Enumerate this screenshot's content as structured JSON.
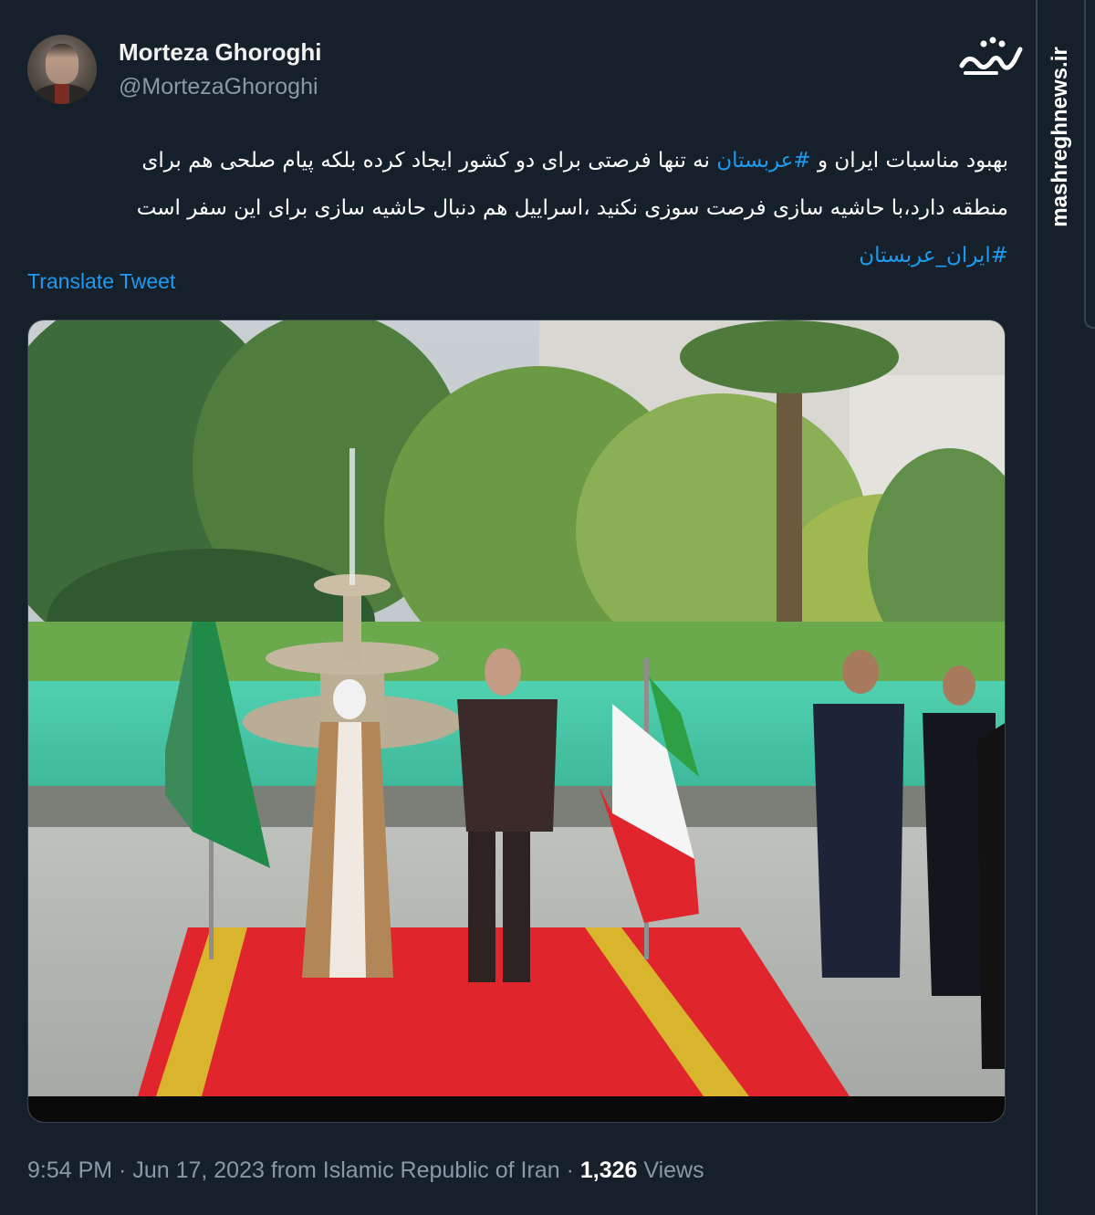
{
  "author": {
    "display_name": "Morteza Ghoroghi",
    "handle": "@MortezaGhoroghi"
  },
  "tweet": {
    "line1_part1": "بهبود مناسبات ایران و ",
    "line1_hashtag": "#عربستان",
    "line1_part2": " نه تنها فرصتی برای دو کشور ایجاد کرده بلکه پیام صلحی هم برای",
    "line2": "منطقه دارد،با حاشیه سازی فرصت سوزی نکنید ،اسراییل هم دنبال حاشیه سازی برای این سفر است",
    "line3_hashtag": "#ایران_عربستان"
  },
  "translate_label": "Translate Tweet",
  "meta": {
    "time": "9:54 PM",
    "sep1": " · ",
    "date": "Jun 17, 2023",
    "source": " from Islamic Republic of Iran",
    "sep2": " · ",
    "views_count": "1,326",
    "views_label": " Views"
  },
  "watermark": {
    "site": "mashreghnews.ir",
    "logo_text": "مشرق"
  },
  "colors": {
    "background": "#15202b",
    "link": "#1d9bf0",
    "secondary_text": "#8b98a5"
  }
}
